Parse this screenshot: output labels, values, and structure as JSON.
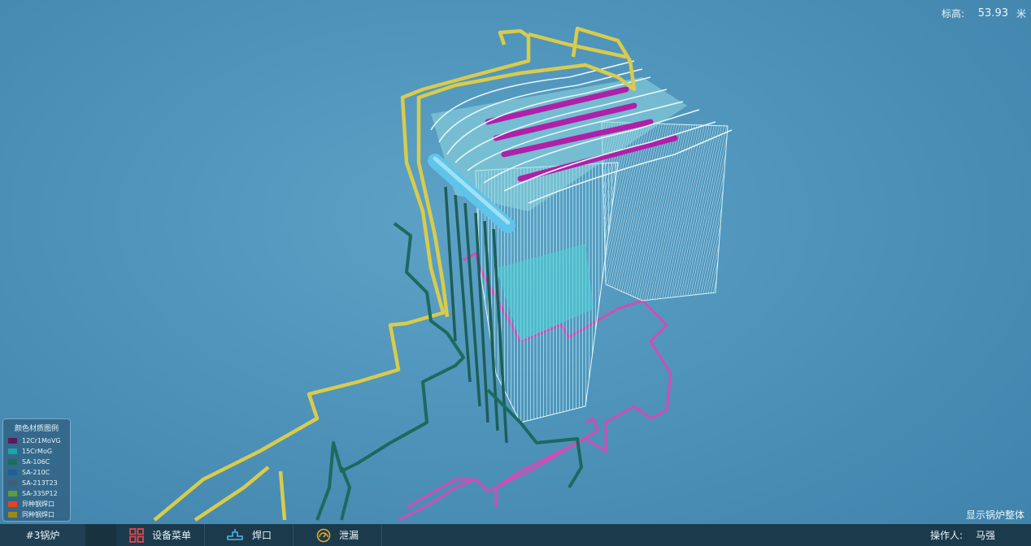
{
  "elevation": {
    "label": "标高:",
    "value": "53.93",
    "unit": "米"
  },
  "legend": {
    "title": "颜色材质图例",
    "items": [
      {
        "label": "12Cr1MoVG",
        "color": "#5a1a58"
      },
      {
        "label": "15CrMoG",
        "color": "#1aa6a6"
      },
      {
        "label": "SA-106C",
        "color": "#1a6e5a"
      },
      {
        "label": "SA-210C",
        "color": "#1f5e96"
      },
      {
        "label": "SA-213T23",
        "color": "#3d5f78"
      },
      {
        "label": "SA-335P12",
        "color": "#5c9e3a"
      },
      {
        "label": "异种钢焊口",
        "color": "#e8451e"
      },
      {
        "label": "同种钢焊口",
        "color": "#9a8a14"
      }
    ]
  },
  "show_whole_label": "显示锅炉整体",
  "bottombar": {
    "title": "#3锅炉",
    "buttons": [
      {
        "label": "设备菜单",
        "icon": "grid-icon",
        "color": "#e0474c"
      },
      {
        "label": "焊口",
        "icon": "pipe-joint-icon",
        "color": "#4fb4e6"
      },
      {
        "label": "泄漏",
        "icon": "gauge-icon",
        "color": "#e8a92a"
      }
    ],
    "operator_label": "操作人:",
    "operator_name": "马强"
  },
  "colors": {
    "yellow_pipe": "#d8c94a",
    "green_pipe": "#1d6a5e",
    "magenta_pipe": "#d04ab0",
    "cyan_tubes": "#7fe0e8",
    "white_tubes": "#dceef5"
  }
}
